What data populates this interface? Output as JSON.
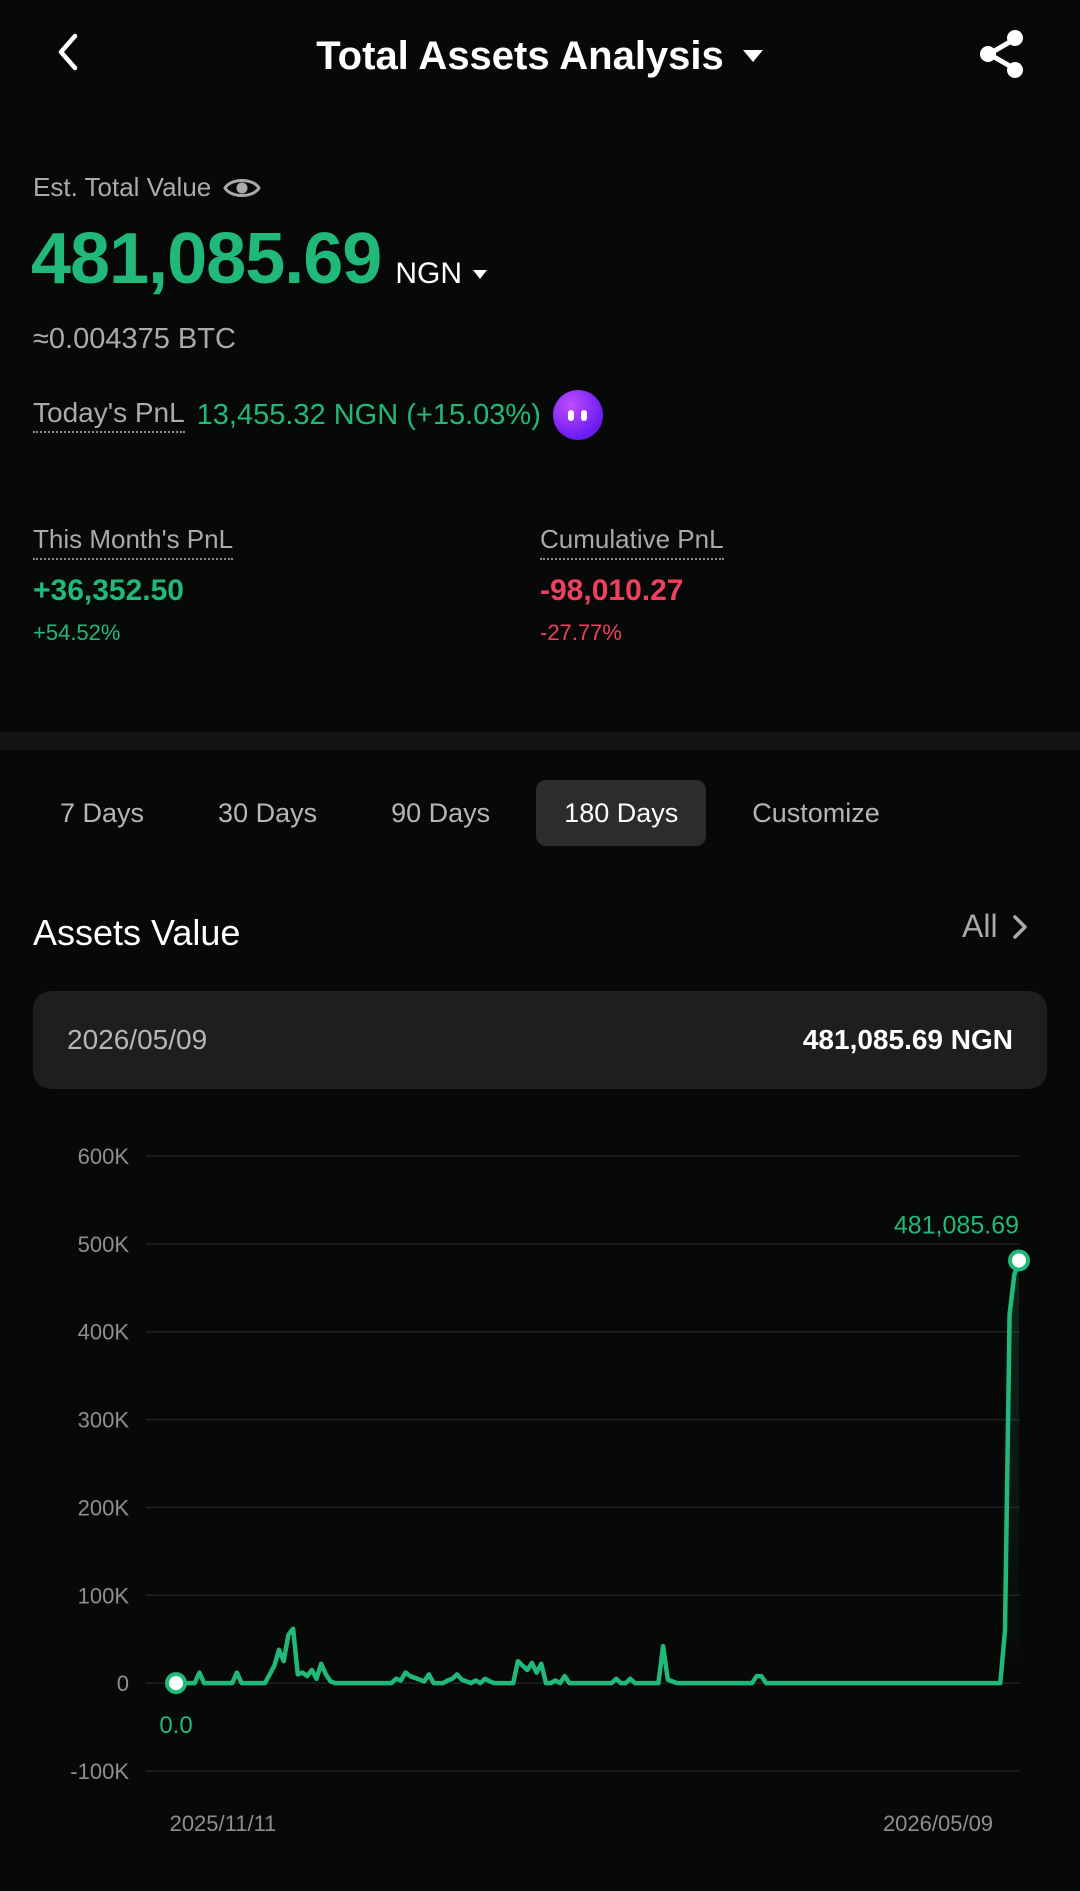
{
  "header": {
    "title": "Total Assets Analysis",
    "back_icon": "chevron-left-icon",
    "share_icon": "share-icon"
  },
  "summary": {
    "est_label": "Est. Total Value",
    "total_value": "481,085.69",
    "currency": "NGN",
    "btc_equiv": "≈0.004375 BTC",
    "todays_pnl_label": "Today's PnL",
    "todays_pnl_value": "13,455.32 NGN (+15.03%)"
  },
  "stats": {
    "month": {
      "label": "This Month's PnL",
      "value": "+36,352.50",
      "pct": "+54.52%"
    },
    "cumulative": {
      "label": "Cumulative PnL",
      "value": "-98,010.27",
      "pct": "-27.77%"
    }
  },
  "tabs": [
    {
      "label": "7 Days",
      "active": false
    },
    {
      "label": "30 Days",
      "active": false
    },
    {
      "label": "90 Days",
      "active": false
    },
    {
      "label": "180 Days",
      "active": true
    },
    {
      "label": "Customize",
      "active": false
    }
  ],
  "assets": {
    "title": "Assets Value",
    "all_label": "All"
  },
  "info_card": {
    "date": "2026/05/09",
    "value": "481,085.69 NGN"
  },
  "colors": {
    "accent_green": "#21b97a",
    "loss_red": "#f0405e",
    "background": "#070808"
  },
  "chart_data": {
    "type": "line",
    "x_start": "2025/11/11",
    "x_end": "2026/05/09",
    "ylim": [
      -100000,
      600000
    ],
    "y_ticks": [
      "600K",
      "500K",
      "400K",
      "300K",
      "200K",
      "100K",
      "0",
      "-100K"
    ],
    "start_label": "0.0",
    "end_label": "481,085.69",
    "series": [
      {
        "values": [
          0,
          0,
          0,
          0,
          0,
          12000,
          0,
          0,
          0,
          0,
          0,
          0,
          0,
          12000,
          0,
          0,
          0,
          0,
          0,
          0,
          10000,
          20000,
          38000,
          25000,
          55000,
          62000,
          10000,
          12000,
          8000,
          15000,
          5000,
          22000,
          10000,
          2000,
          0,
          0,
          0,
          0,
          0,
          0,
          0,
          0,
          0,
          0,
          0,
          0,
          0,
          5000,
          3000,
          12000,
          8000,
          6000,
          4000,
          2000,
          10000,
          0,
          0,
          0,
          3000,
          5000,
          10000,
          4000,
          2000,
          0,
          3000,
          0,
          5000,
          2000,
          0,
          0,
          0,
          0,
          0,
          25000,
          20000,
          15000,
          23000,
          12000,
          22000,
          0,
          0,
          3000,
          0,
          8000,
          0,
          0,
          0,
          0,
          0,
          0,
          0,
          0,
          0,
          0,
          5000,
          0,
          0,
          5000,
          0,
          0,
          0,
          0,
          0,
          0,
          42000,
          4000,
          2000,
          0,
          0,
          0,
          0,
          0,
          0,
          0,
          0,
          0,
          0,
          0,
          0,
          0,
          0,
          0,
          0,
          0,
          8000,
          8000,
          0,
          0,
          0,
          0,
          0,
          0,
          0,
          0,
          0,
          0,
          0,
          0,
          0,
          0,
          0,
          0,
          0,
          0,
          0,
          0,
          0,
          0,
          0,
          0,
          0,
          0,
          0,
          0,
          0,
          0,
          0,
          0,
          0,
          0,
          0,
          0,
          0,
          0,
          0,
          0,
          0,
          0,
          0,
          0,
          0,
          0,
          0,
          0,
          0,
          0,
          0,
          60000,
          420000,
          465000,
          481085.69
        ]
      }
    ]
  }
}
